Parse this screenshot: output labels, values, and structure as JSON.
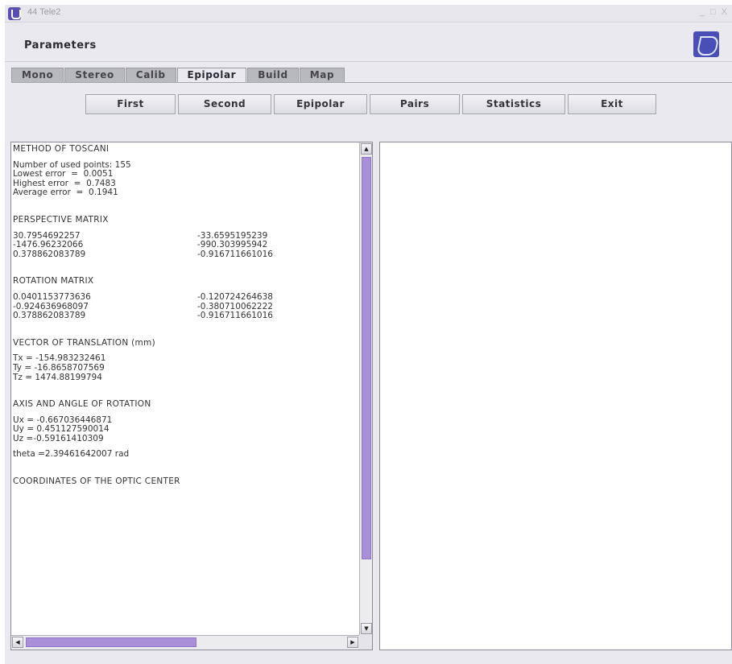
{
  "window": {
    "title": "44 Tele2",
    "controls": "_ □ X"
  },
  "header": {
    "title": "Parameters"
  },
  "tabs": [
    {
      "label": "Mono"
    },
    {
      "label": "Stereo"
    },
    {
      "label": "Calib"
    },
    {
      "label": "Epipolar",
      "active": true
    },
    {
      "label": "Build"
    },
    {
      "label": "Map"
    }
  ],
  "toolbar": {
    "first": "First",
    "second": "Second",
    "epipolar": "Epipolar",
    "pairs": "Pairs",
    "statistics": "Statistics",
    "exit": "Exit"
  },
  "report": {
    "method": "METHOD OF TOSCANI",
    "used_points": "Number of used points: 155",
    "lowest_error": "Lowest error  =  0.0051",
    "highest_error": "Highest error  =  0.7483",
    "average_error": "Average error  =  0.1941",
    "perspective_title": "PERSPECTIVE MATRIX",
    "perspective": [
      [
        "30.7954692257",
        "-33.6595195239"
      ],
      [
        "-1476.96232066",
        "-990.303995942"
      ],
      [
        "0.378862083789",
        "-0.916711661016"
      ]
    ],
    "rotation_title": "ROTATION MATRIX",
    "rotation": [
      [
        "0.0401153773636",
        "-0.120724264638"
      ],
      [
        "-0.924636968097",
        "-0.380710062222"
      ],
      [
        "0.378862083789",
        "-0.916711661016"
      ]
    ],
    "translation_title": "VECTOR OF TRANSLATION (mm)",
    "tx": "Tx = -154.983232461",
    "ty": "Ty = -16.8658707569",
    "tz": "Tz = 1474.88199794",
    "axis_title": "AXIS AND ANGLE OF ROTATION",
    "ux": "Ux = -0.667036446871",
    "uy": "Uy = 0.451127590014",
    "uz": "Uz =-0.59161410309",
    "theta": "theta =2.39461642007 rad",
    "optic_title": "COORDINATES OF THE OPTIC CENTER"
  },
  "scroll": {
    "vertical_position": 0.02,
    "horizontal_position": 0.0
  }
}
